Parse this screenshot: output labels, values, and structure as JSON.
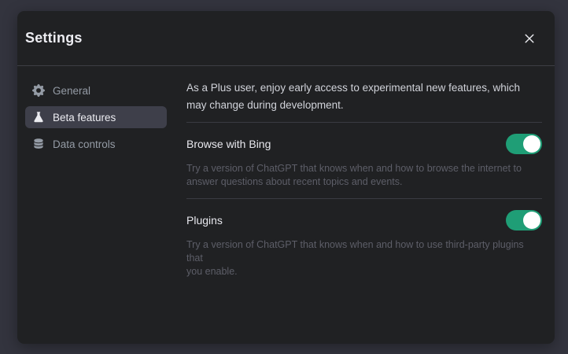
{
  "dialog": {
    "title": "Settings"
  },
  "sidebar": {
    "items": [
      {
        "label": "General",
        "icon": "gear-icon",
        "active": false
      },
      {
        "label": "Beta features",
        "icon": "flask-icon",
        "active": true
      },
      {
        "label": "Data controls",
        "icon": "database-icon",
        "active": false
      }
    ]
  },
  "content": {
    "intro": "As a Plus user, enjoy early access to experimental new features, which\nmay change during development.",
    "sections": [
      {
        "title": "Browse with Bing",
        "toggle": "on",
        "description": "Try a version of ChatGPT that knows when and how to browse the internet to\nanswer questions about recent topics and events."
      },
      {
        "title": "Plugins",
        "toggle": "on",
        "description": "Try a version of ChatGPT that knows when and how to use third-party plugins that\nyou enable."
      }
    ]
  },
  "colors": {
    "backdrop": "#33343e",
    "dialog_bg": "#202123",
    "active_item_bg": "#3e3f4a",
    "accent_green": "#1f9e76",
    "primary_text": "#ececf1",
    "muted_text": "#5d5e68"
  }
}
